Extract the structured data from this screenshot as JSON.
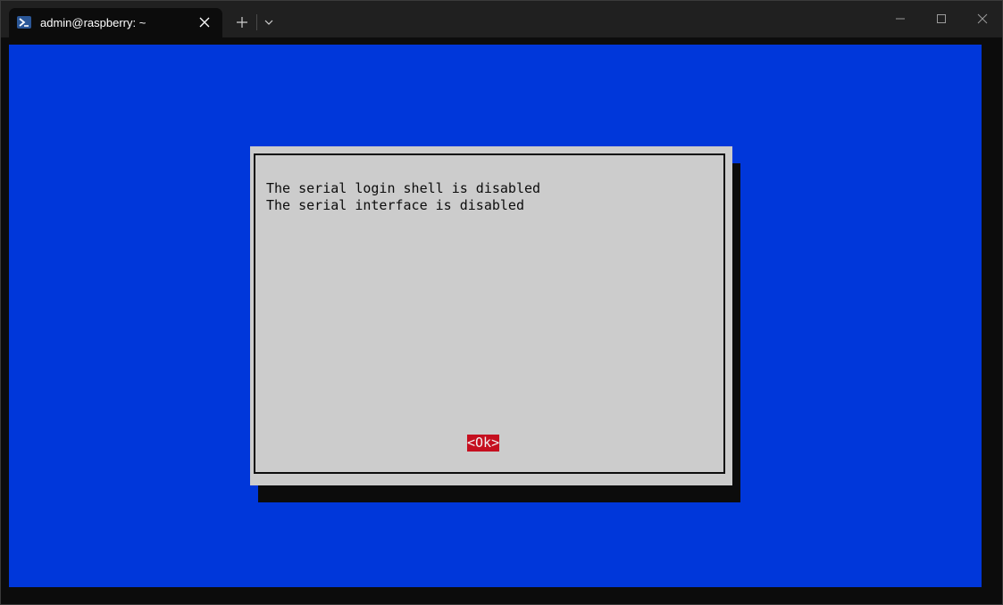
{
  "window": {
    "tab_title": "admin@raspberry: ~",
    "tab_icon": "powershell-icon",
    "close_tab_icon": "close-icon",
    "new_tab_icon": "plus-icon",
    "dropdown_icon": "chevron-down-icon",
    "minimize_icon": "minimize-icon",
    "maximize_icon": "maximize-icon",
    "close_window_icon": "close-icon"
  },
  "colors": {
    "terminal_background": "#0037da",
    "dialog_background": "#cccccc",
    "button_highlight": "#c50f1f",
    "titlebar": "#202020"
  },
  "dialog": {
    "lines": [
      "The serial login shell is disabled",
      "The serial interface is disabled"
    ],
    "ok_label": "<Ok>"
  }
}
